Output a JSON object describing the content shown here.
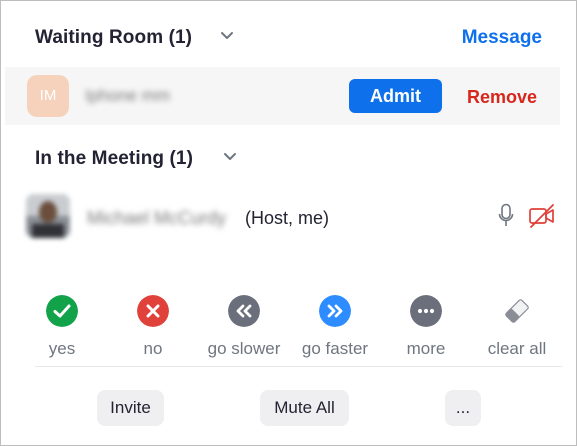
{
  "waiting_room": {
    "title": "Waiting Room (1)",
    "message_label": "Message",
    "participant": {
      "initials": "IM",
      "name_obscured": "Iphone mm",
      "avatar_color": "#f6d2bd"
    },
    "admit_label": "Admit",
    "remove_label": "Remove"
  },
  "meeting": {
    "title": "In the Meeting (1)",
    "participant": {
      "name_obscured": "Michael McCurdy",
      "role_tag": "(Host, me)",
      "mic_icon": "microphone-icon",
      "video_icon": "video-off-icon"
    }
  },
  "reactions": [
    {
      "label": "yes",
      "icon": "check-icon",
      "color": "#12a34a"
    },
    {
      "label": "no",
      "icon": "x-icon",
      "color": "#e0413a"
    },
    {
      "label": "go slower",
      "icon": "rewind-icon",
      "color": "#6b6f7c"
    },
    {
      "label": "go faster",
      "icon": "fast-forward-icon",
      "color": "#2d8cff"
    },
    {
      "label": "more",
      "icon": "ellipsis-icon",
      "color": "#6b6f7c"
    },
    {
      "label": "clear all",
      "icon": "eraser-icon",
      "color": "#8a8d96"
    }
  ],
  "footer": {
    "invite_label": "Invite",
    "mute_all_label": "Mute All",
    "more_label": "..."
  },
  "colors": {
    "accent_blue": "#0e71eb",
    "danger_red": "#d7261c",
    "text_dark": "#232333",
    "text_muted": "#6e7680"
  }
}
